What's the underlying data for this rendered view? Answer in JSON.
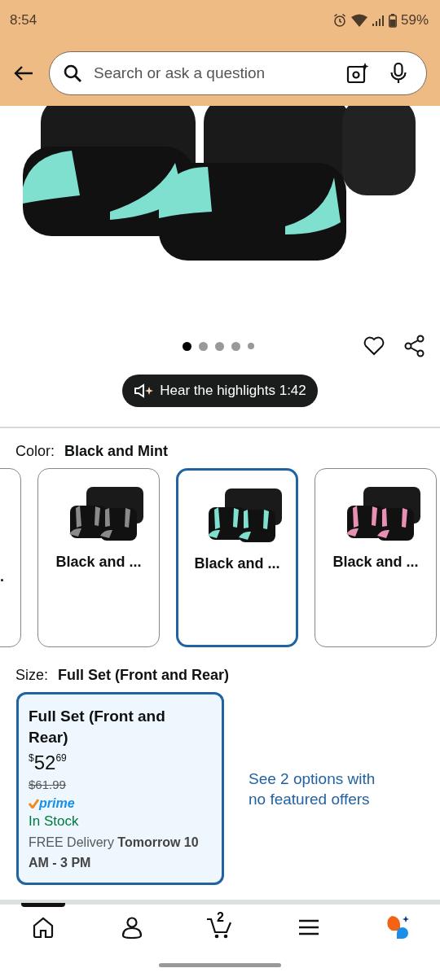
{
  "status_bar": {
    "time": "8:54",
    "battery": "59%"
  },
  "search": {
    "placeholder": "Search or ask a question"
  },
  "gallery": {
    "dots": [
      {
        "selected": true
      },
      {
        "selected": false
      },
      {
        "selected": false
      },
      {
        "selected": false
      },
      {
        "selected": false
      }
    ],
    "favorite": false
  },
  "audio_button": {
    "label": "Hear the highlights 1:42"
  },
  "color": {
    "label": "Color:",
    "value": "Black and Mint"
  },
  "swatches": [
    {
      "label": ".",
      "selected": false
    },
    {
      "label": "Black and ...",
      "selected": false,
      "color": "#8a8a8a"
    },
    {
      "label": "Black and ...",
      "selected": true,
      "color": "#7fe0d0"
    },
    {
      "label": "Black and ...",
      "selected": false,
      "color": "#e88fb4"
    }
  ],
  "size": {
    "label": "Size:",
    "value": "Full Set (Front and Rear)"
  },
  "size_option": {
    "title": "Full Set (Front and Rear)",
    "selected": true,
    "currency": "$",
    "price_whole": "52",
    "price_fraction": "69",
    "list_price": "$61.99",
    "prime": "prime",
    "stock": "In Stock",
    "delivery": "FREE Delivery **Tomorrow 10 AM - 3 PM**"
  },
  "options_link": "See 2 options with no featured offers",
  "bottom_nav": [
    {
      "kind": "home",
      "selected": true
    },
    {
      "kind": "account",
      "selected": false
    },
    {
      "kind": "cart",
      "selected": false,
      "badge": "2"
    },
    {
      "kind": "menu",
      "selected": false
    },
    {
      "kind": "assistant",
      "selected": false
    }
  ]
}
